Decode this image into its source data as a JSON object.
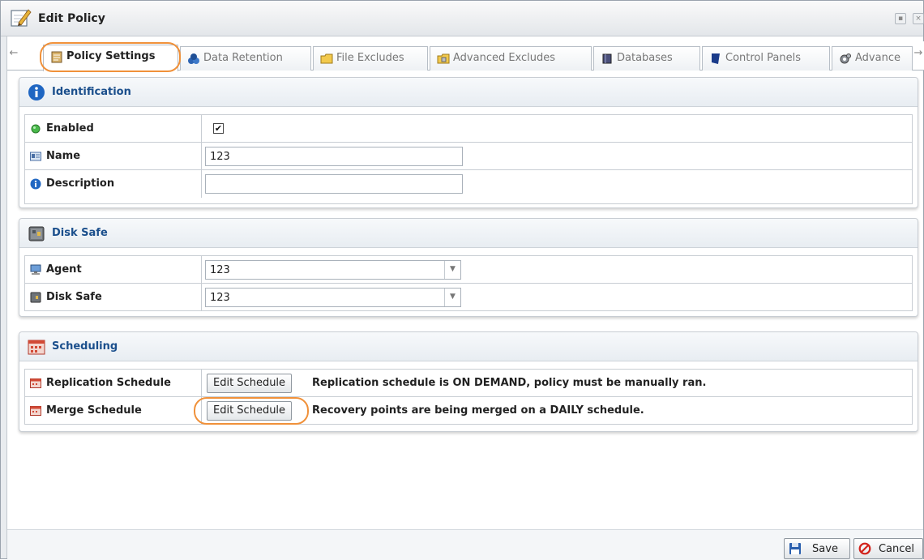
{
  "window": {
    "title": "Edit Policy"
  },
  "tabs": [
    {
      "label": "Policy Settings",
      "icon": "policy-settings-icon",
      "active": true
    },
    {
      "label": "Data Retention",
      "icon": "data-retention-icon"
    },
    {
      "label": "File Excludes",
      "icon": "file-excludes-icon"
    },
    {
      "label": "Advanced Excludes",
      "icon": "advanced-excludes-icon"
    },
    {
      "label": "Databases",
      "icon": "databases-icon"
    },
    {
      "label": "Control Panels",
      "icon": "control-panels-icon"
    },
    {
      "label": "Advance",
      "icon": "advanced-icon"
    }
  ],
  "identification": {
    "title": "Identification",
    "enabled_label": "Enabled",
    "enabled_checked": true,
    "checkmark": "✔",
    "name_label": "Name",
    "name_value": "123",
    "description_label": "Description",
    "description_value": ""
  },
  "disk_safe": {
    "title": "Disk Safe",
    "agent_label": "Agent",
    "agent_value": "123",
    "disk_safe_label": "Disk Safe",
    "disk_safe_value": "123"
  },
  "scheduling": {
    "title": "Scheduling",
    "replication_label": "Replication Schedule",
    "replication_button": "Edit Schedule",
    "replication_text": "Replication schedule is ON DEMAND, policy must be manually ran.",
    "merge_label": "Merge Schedule",
    "merge_button": "Edit Schedule",
    "merge_text": "Recovery points are being merged on a DAILY schedule."
  },
  "footer": {
    "save_label": "Save",
    "cancel_label": "Cancel"
  },
  "colors": {
    "accent": "#1b4f8c",
    "highlight": "#f0913a"
  }
}
